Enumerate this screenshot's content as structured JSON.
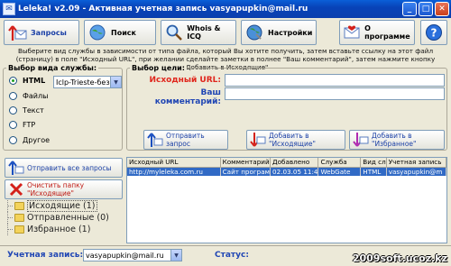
{
  "window": {
    "title": "Leleka! v2.09 - Активная учетная запись vasyapupkin@mail.ru"
  },
  "toolbar": {
    "requests": "Запросы",
    "search": "Поиск",
    "whois": "Whois & ICQ",
    "settings": "Настройки",
    "about": "О программе"
  },
  "hint": "Выберите вид службы в зависимости от типа файла, который Вы хотите получить, затем вставьте ссылку на этот файл (страницу) в поле \"Исходный URL\", при желании сделайте заметки в полнее \"Ваш комментарий\", затем нажмите кнопку \"Добавить в Исходящие\"",
  "service": {
    "legend": "Выбор вида службы:",
    "options": [
      "HTML",
      "Файлы",
      "Текст",
      "FTP",
      "Другое"
    ],
    "selected_index": 0,
    "dropdown_value": "Iclp-Trieste-без.."
  },
  "target": {
    "legend": "Выбор цели:",
    "url_label": "Исходный URL:",
    "comment_label": "Ваш комментарий:",
    "url_value": "",
    "comment_value": ""
  },
  "actions": {
    "send": "Отправить запрос",
    "add_outbox": "Добавить в \"Исходящие\"",
    "add_favorites": "Добавить в \"Избранное\""
  },
  "left": {
    "send_all": "Отправить все запросы",
    "clear_outbox": "Очистить папку \"Исходящие\""
  },
  "folders": [
    {
      "label": "Исходящие (1)"
    },
    {
      "label": "Отправленные (0)"
    },
    {
      "label": "Избранное (1)"
    }
  ],
  "grid": {
    "columns": [
      "Исходный URL",
      "Комментарий",
      "Добавлено",
      "Служба",
      "Вид сл",
      "Учетная запись"
    ],
    "rows": [
      [
        "http://myleleka.com.ru",
        "Сайт програм",
        "02.03.05 11:4",
        "WebGate",
        "HTML",
        "vasyapupkin@m"
      ]
    ]
  },
  "status": {
    "account_label": "Учетная запись:",
    "account_value": "vasyapupkin@mail.ru",
    "status_label": "Статус:"
  },
  "watermark": "2009soft.ucoz.kz",
  "colors": {
    "accent": "#2046b4",
    "title_bar": "#0b4ec0",
    "red_label": "#e0261c",
    "selection": "#316ac5"
  }
}
